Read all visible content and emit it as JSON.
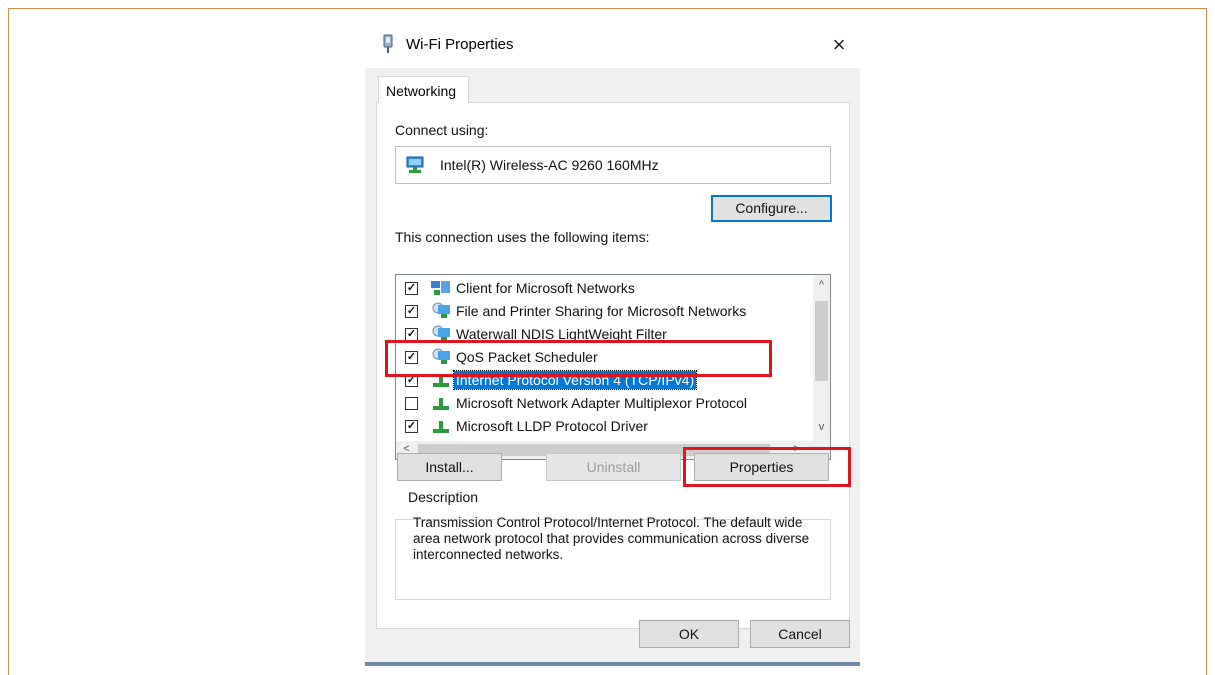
{
  "dialog": {
    "title": "Wi-Fi Properties",
    "title_icon": "network-adapter-icon",
    "close_glyph": "×"
  },
  "tabs": [
    {
      "label": "Networking"
    }
  ],
  "connect_using": {
    "label": "Connect using:",
    "adapter_icon": "network-adapter-icon",
    "adapter_name": "Intel(R) Wireless-AC 9260 160MHz",
    "configure_label": "Configure..."
  },
  "items": {
    "label": "This connection uses the following items:",
    "list": [
      {
        "label": "Client for Microsoft Networks",
        "checked": true,
        "icon": "network-client-icon"
      },
      {
        "label": "File and Printer Sharing for Microsoft Networks",
        "checked": true,
        "icon": "network-service-icon"
      },
      {
        "label": "Waterwall NDIS LightWeight Filter",
        "checked": true,
        "icon": "network-service-icon"
      },
      {
        "label": "QoS Packet Scheduler",
        "checked": true,
        "icon": "network-service-icon"
      },
      {
        "label": "Internet Protocol Version 4 (TCP/IPv4)",
        "checked": true,
        "icon": "protocol-icon",
        "selected": true
      },
      {
        "label": "Microsoft Network Adapter Multiplexor Protocol",
        "checked": false,
        "icon": "protocol-icon"
      },
      {
        "label": "Microsoft LLDP Protocol Driver",
        "checked": true,
        "icon": "protocol-icon"
      }
    ],
    "scroll_up": "^",
    "scroll_down": "v",
    "scroll_left": "<",
    "scroll_right": ">"
  },
  "buttons": {
    "install": "Install...",
    "uninstall": "Uninstall",
    "properties": "Properties",
    "ok": "OK",
    "cancel": "Cancel"
  },
  "description": {
    "title": "Description",
    "text": "Transmission Control Protocol/Internet Protocol. The default wide area network protocol that provides communication across diverse interconnected networks."
  },
  "colors": {
    "highlight_box": "#e0141c",
    "selection": "#0078d7",
    "frame_border": "#d58b45"
  }
}
